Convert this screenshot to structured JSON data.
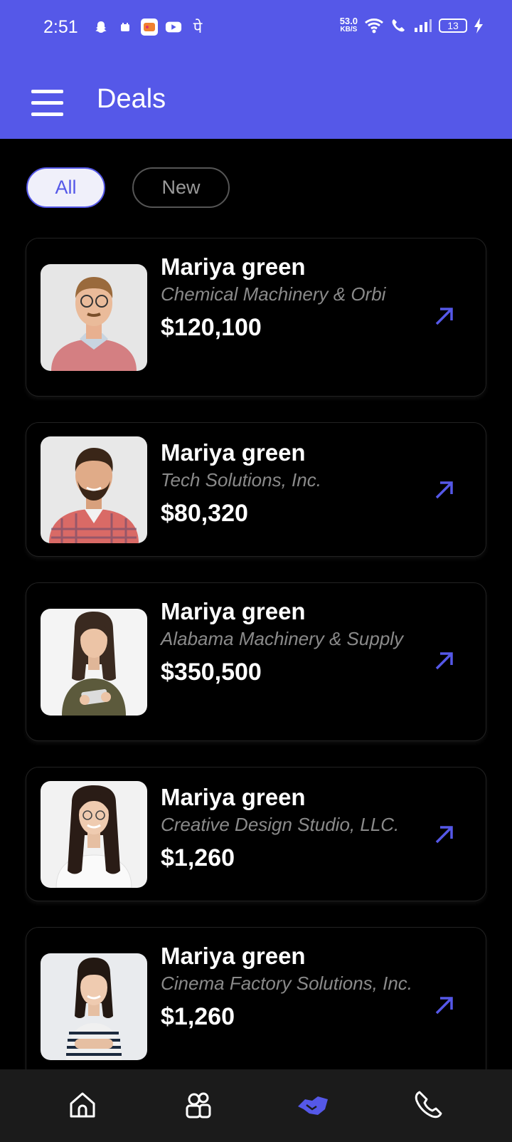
{
  "status_bar": {
    "time": "2:51",
    "net_speed": "53.0",
    "net_unit": "KB/S",
    "battery": "13"
  },
  "header": {
    "title": "Deals",
    "menu_icon": "hamburger-menu-icon"
  },
  "filters": [
    {
      "label": "All",
      "active": true
    },
    {
      "label": "New",
      "active": false
    }
  ],
  "deals": [
    {
      "name": "Mariya green",
      "company": "Chemical Machinery & Orbi",
      "amount": "$120,100"
    },
    {
      "name": "Mariya green",
      "company": "Tech Solutions, Inc.",
      "amount": "$80,320"
    },
    {
      "name": "Mariya green",
      "company": "Alabama Machinery & Supply",
      "amount": "$350,500"
    },
    {
      "name": "Mariya green",
      "company": "Creative Design Studio, LLC.",
      "amount": "$1,260"
    },
    {
      "name": "Mariya green",
      "company": "Cinema Factory Solutions, Inc.",
      "amount": "$1,260"
    }
  ],
  "bottom_nav": [
    {
      "icon": "home-icon",
      "active": false
    },
    {
      "icon": "contacts-icon",
      "active": false
    },
    {
      "icon": "handshake-icon",
      "active": true
    },
    {
      "icon": "phone-icon",
      "active": false
    }
  ],
  "colors": {
    "accent": "#5558E8",
    "background": "#000000",
    "muted_text": "#8a8a8a"
  }
}
